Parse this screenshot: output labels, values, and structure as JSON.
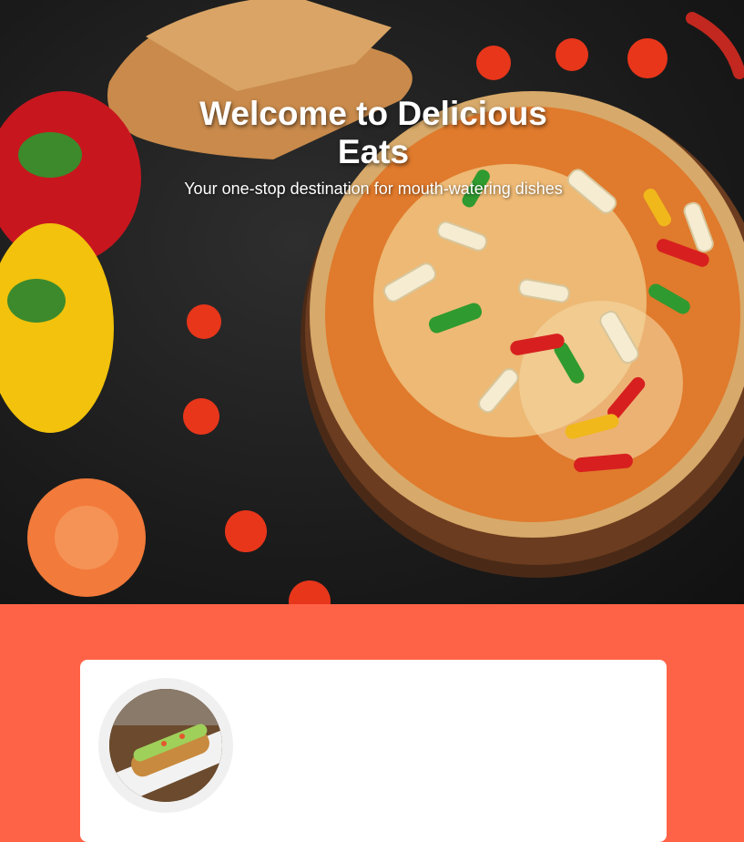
{
  "hero": {
    "title": "Welcome to Delicious Eats",
    "subtitle": "Your one-stop destination for mouth-watering dishes",
    "image_alt": "pizza-with-peppers-and-tomatoes"
  },
  "featured": {
    "image_alt": "sushi-roll-plate"
  },
  "colors": {
    "accent": "#ff6347",
    "card": "#ffffff",
    "hero_bg": "#1b1b1b"
  }
}
